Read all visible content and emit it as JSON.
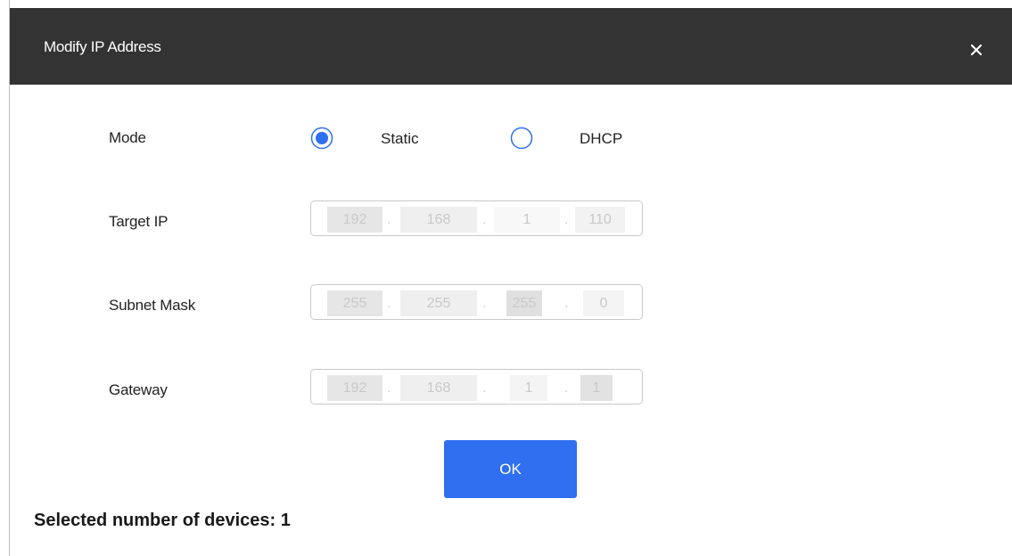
{
  "dialog": {
    "title": "Modify IP Address",
    "close_icon": "close-icon"
  },
  "mode": {
    "label": "Mode",
    "options": [
      {
        "label": "Static",
        "selected": true
      },
      {
        "label": "DHCP",
        "selected": false
      }
    ],
    "accent_color": "#2f6ff0"
  },
  "fields": {
    "target_ip": {
      "label": "Target IP",
      "segments": [
        "192",
        "168",
        "1",
        "110"
      ]
    },
    "subnet_mask": {
      "label": "Subnet Mask",
      "segments": [
        "255",
        "255",
        "255",
        "0"
      ]
    },
    "gateway": {
      "label": "Gateway",
      "segments": [
        "192",
        "168",
        "1",
        "1"
      ]
    }
  },
  "ok_button": {
    "label": "OK"
  },
  "footer": {
    "selected_count_text": "Selected number of devices: 1"
  },
  "colors": {
    "titlebar": "#333333",
    "primary": "#2f6ff0"
  }
}
